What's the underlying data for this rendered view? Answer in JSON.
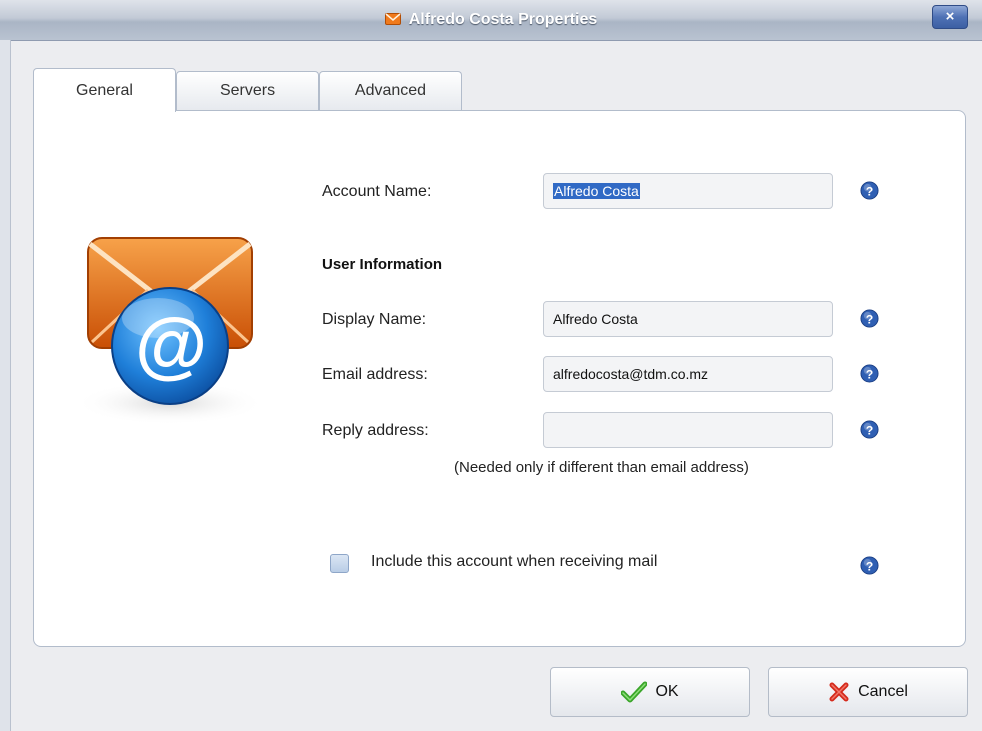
{
  "window": {
    "title": "Alfredo Costa Properties",
    "close_label": "×"
  },
  "tabs": [
    {
      "label": "General",
      "active": true
    },
    {
      "label": "Servers",
      "active": false
    },
    {
      "label": "Advanced",
      "active": false
    }
  ],
  "form": {
    "account_name_label": "Account Name:",
    "account_name_value": "Alfredo Costa",
    "user_info_heading": "User Information",
    "display_name_label": "Display Name:",
    "display_name_value": "Alfredo Costa",
    "email_label": "Email address:",
    "email_value": "alfredocosta@tdm.co.mz",
    "reply_label": "Reply address:",
    "reply_value": "",
    "reply_note": "(Needed only if different than email address)",
    "include_label": "Include this account when receiving mail",
    "include_checked": false
  },
  "buttons": {
    "ok": "OK",
    "cancel": "Cancel"
  },
  "colors": {
    "selection": "#316ac5",
    "help_icon": "#2f5fb3",
    "envelope": "#e8731c",
    "at_badge": "#1f7fd9"
  }
}
